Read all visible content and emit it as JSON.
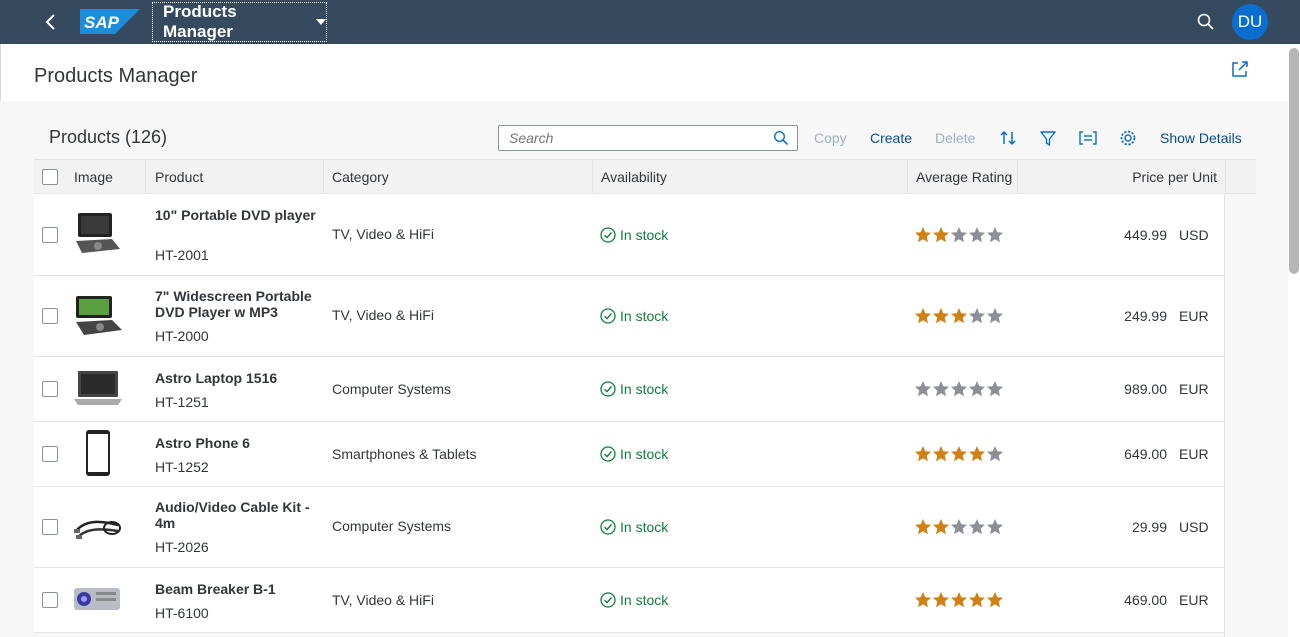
{
  "shell": {
    "app_title": "Products Manager",
    "avatar_initials": "DU",
    "logo_text": "SAP",
    "colors": {
      "shell_bg": "#354a5f",
      "avatar_bg": "#0a6ed1",
      "link": "#0a6ed1"
    }
  },
  "page": {
    "title": "Products Manager"
  },
  "toolbar": {
    "title": "Products (126)",
    "search_placeholder": "Search",
    "copy_label": "Copy",
    "create_label": "Create",
    "delete_label": "Delete",
    "show_details_label": "Show Details"
  },
  "table": {
    "columns": [
      "Image",
      "Product",
      "Category",
      "Availability",
      "Average Rating",
      "Price per Unit"
    ],
    "rows": [
      {
        "name": "10\" Portable DVD player",
        "id": "HT-2001",
        "category": "TV, Video & HiFi",
        "availability": "In stock",
        "rating": 2,
        "price": "449.99",
        "currency": "USD",
        "image_icon": "portable-dvd-icon"
      },
      {
        "name": "7\" Widescreen Portable DVD Player w MP3",
        "id": "HT-2000",
        "category": "TV, Video & HiFi",
        "availability": "In stock",
        "rating": 3,
        "price": "249.99",
        "currency": "EUR",
        "image_icon": "widescreen-dvd-icon"
      },
      {
        "name": "Astro Laptop 1516",
        "id": "HT-1251",
        "category": "Computer Systems",
        "availability": "In stock",
        "rating": 0,
        "price": "989.00",
        "currency": "EUR",
        "image_icon": "laptop-icon"
      },
      {
        "name": "Astro Phone 6",
        "id": "HT-1252",
        "category": "Smartphones & Tablets",
        "availability": "In stock",
        "rating": 4,
        "price": "649.00",
        "currency": "EUR",
        "image_icon": "phone-icon"
      },
      {
        "name": "Audio/Video Cable Kit - 4m",
        "id": "HT-2026",
        "category": "Computer Systems",
        "availability": "In stock",
        "rating": 2,
        "price": "29.99",
        "currency": "USD",
        "image_icon": "cable-kit-icon"
      },
      {
        "name": "Beam Breaker B-1",
        "id": "HT-6100",
        "category": "TV, Video & HiFi",
        "availability": "In stock",
        "rating": 5,
        "price": "469.00",
        "currency": "EUR",
        "image_icon": "projector-icon"
      }
    ]
  }
}
